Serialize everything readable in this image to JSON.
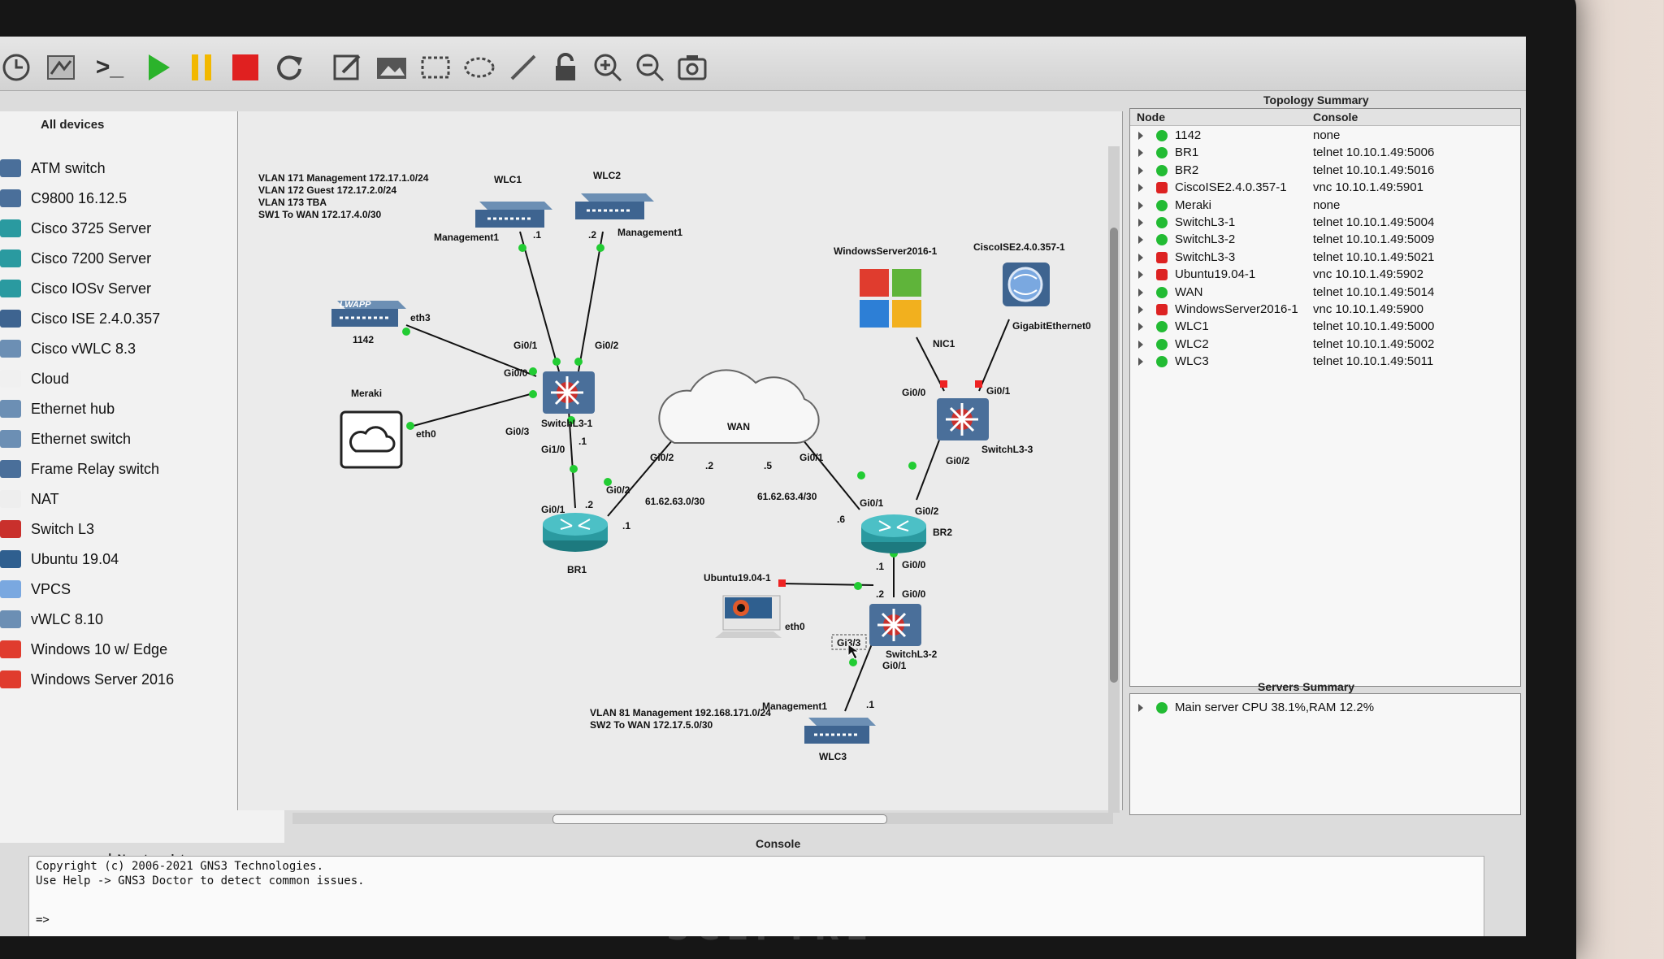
{
  "brand": {
    "name": "SCEPTRE"
  },
  "toolbar": {
    "tools": [
      "history-icon",
      "snapshot-icon",
      "console-icon",
      "start-icon",
      "suspend-icon",
      "stop-icon",
      "reload-icon",
      "note-icon",
      "image-icon",
      "rectangle-icon",
      "ellipse-icon",
      "line-icon",
      "lock-icon",
      "zoom-in-icon",
      "zoom-out-icon",
      "screenshot-icon"
    ],
    "console_glyph": ">_"
  },
  "devices_panel": {
    "title": "All devices",
    "items": [
      {
        "label": "ATM switch",
        "icon": "atm-switch-icon"
      },
      {
        "label": "C9800 16.12.5",
        "icon": "c9800-icon"
      },
      {
        "label": "Cisco 3725 Server",
        "icon": "router-icon"
      },
      {
        "label": "Cisco 7200 Server",
        "icon": "router-icon"
      },
      {
        "label": "Cisco IOSv Server",
        "icon": "router-icon"
      },
      {
        "label": "Cisco ISE 2.4.0.357",
        "icon": "ise-icon"
      },
      {
        "label": "Cisco vWLC 8.3",
        "icon": "wlc-icon"
      },
      {
        "label": "Cloud",
        "icon": "cloud-icon"
      },
      {
        "label": "Ethernet hub",
        "icon": "hub-icon"
      },
      {
        "label": "Ethernet switch",
        "icon": "switch-icon"
      },
      {
        "label": "Frame Relay switch",
        "icon": "frame-relay-icon"
      },
      {
        "label": "NAT",
        "icon": "nat-icon"
      },
      {
        "label": "Switch L3",
        "icon": "switch-l3-icon"
      },
      {
        "label": "Ubuntu 19.04",
        "icon": "ubuntu-icon"
      },
      {
        "label": "VPCS",
        "icon": "vpcs-icon"
      },
      {
        "label": "vWLC 8.10",
        "icon": "wlc-icon"
      },
      {
        "label": "Windows 10 w/ Edge",
        "icon": "windows-icon"
      },
      {
        "label": "Windows Server 2016",
        "icon": "windows-icon"
      }
    ],
    "new_template": "New template"
  },
  "topology": {
    "notes": {
      "vlan_top": [
        "VLAN 171 Management 172.17.1.0/24",
        "VLAN 172 Guest 172.17.2.0/24",
        "VLAN 173 TBA",
        "SW1 To WAN 172.17.4.0/30"
      ],
      "vlan_bottom": [
        "VLAN 81 Management 192.168.171.0/24",
        "SW2 To WAN 172.17.5.0/30"
      ]
    },
    "nodes": {
      "wlc1": "WLC1",
      "wlc2": "WLC2",
      "ap1142": "1142",
      "meraki": "Meraki",
      "sw1": "SwitchL3-1",
      "br1": "BR1",
      "wan": "WAN",
      "br2": "BR2",
      "sw3": "SwitchL3-3",
      "winserver": "WindowsServer2016-1",
      "ise": "CiscoISE2.4.0.357-1",
      "ubuntu": "Ubuntu19.04-1",
      "sw2": "SwitchL3-2",
      "wlc3": "WLC3",
      "lwapp": "LWAPP"
    },
    "interfaces": {
      "mgmt1_a": "Management1",
      "mgmt1_b": "Management1",
      "mgmt1_c": "Management1",
      "dot1_a": ".1",
      "dot2_a": ".2",
      "gi01_sw1": "Gi0/1",
      "gi02_sw1": "Gi0/2",
      "gi00_sw1": "Gi0/0",
      "gi03_sw1": "Gi0/3",
      "gi10_sw1": "Gi1/0",
      "dot1_sw1": ".1",
      "eth3": "eth3",
      "eth0_meraki": "eth0",
      "gi01_br1": "Gi0/1",
      "dot2_br1": ".2",
      "gi02_br1": "Gi0/2",
      "dot1_br1": ".1",
      "net_left": "61.62.63.0/30",
      "gi02_wan": "Gi0/2",
      "dot2_wan": ".2",
      "dot5_wan": ".5",
      "gi01_wan": "Gi0/1",
      "net_right": "61.62.63.4/30",
      "gi01_br2": "Gi0/1",
      "dot6_br2": ".6",
      "gi02_br2": "Gi0/2",
      "dot1_br2": ".1",
      "gi00_br2": "Gi0/0",
      "dot2_sw2": ".2",
      "gi00_sw2": "Gi0/0",
      "gi00_sw3": "Gi0/0",
      "gi01_sw3": "Gi0/1",
      "gi02_sw3": "Gi0/2",
      "nic1": "NIC1",
      "gige0": "GigabitEthernet0",
      "eth0_ubuntu": "eth0",
      "gi33": "Gi3/3",
      "gi01_sw2": "Gi0/1",
      "dot1_wlc3": ".1",
      "wan_cloud": "WAN"
    }
  },
  "topology_summary": {
    "title": "Topology Summary",
    "columns": [
      "Node",
      "Console"
    ],
    "rows": [
      {
        "node": "1142",
        "console": "none",
        "status": "started"
      },
      {
        "node": "BR1",
        "console": "telnet 10.10.1.49:5006",
        "status": "started"
      },
      {
        "node": "BR2",
        "console": "telnet 10.10.1.49:5016",
        "status": "started"
      },
      {
        "node": "CiscoISE2.4.0.357-1",
        "console": "vnc 10.10.1.49:5901",
        "status": "stopped"
      },
      {
        "node": "Meraki",
        "console": "none",
        "status": "started"
      },
      {
        "node": "SwitchL3-1",
        "console": "telnet 10.10.1.49:5004",
        "status": "started"
      },
      {
        "node": "SwitchL3-2",
        "console": "telnet 10.10.1.49:5009",
        "status": "started"
      },
      {
        "node": "SwitchL3-3",
        "console": "telnet 10.10.1.49:5021",
        "status": "stopped"
      },
      {
        "node": "Ubuntu19.04-1",
        "console": "vnc 10.10.1.49:5902",
        "status": "stopped"
      },
      {
        "node": "WAN",
        "console": "telnet 10.10.1.49:5014",
        "status": "started"
      },
      {
        "node": "WindowsServer2016-1",
        "console": "vnc 10.10.1.49:5900",
        "status": "stopped"
      },
      {
        "node": "WLC1",
        "console": "telnet 10.10.1.49:5000",
        "status": "started"
      },
      {
        "node": "WLC2",
        "console": "telnet 10.10.1.49:5002",
        "status": "started"
      },
      {
        "node": "WLC3",
        "console": "telnet 10.10.1.49:5011",
        "status": "started"
      }
    ]
  },
  "servers_summary": {
    "title": "Servers Summary",
    "line": "Main server CPU 38.1%,RAM 12.2%"
  },
  "console": {
    "title": "Console",
    "lines": [
      "Copyright (c) 2006-2021 GNS3 Technologies.",
      "Use Help -> GNS3 Doctor to detect common issues.",
      "=>"
    ]
  },
  "colors": {
    "link_up": "#22cc33",
    "link_down": "#ee2222",
    "status_started": "#22bb33",
    "status_stopped": "#dd2222"
  }
}
